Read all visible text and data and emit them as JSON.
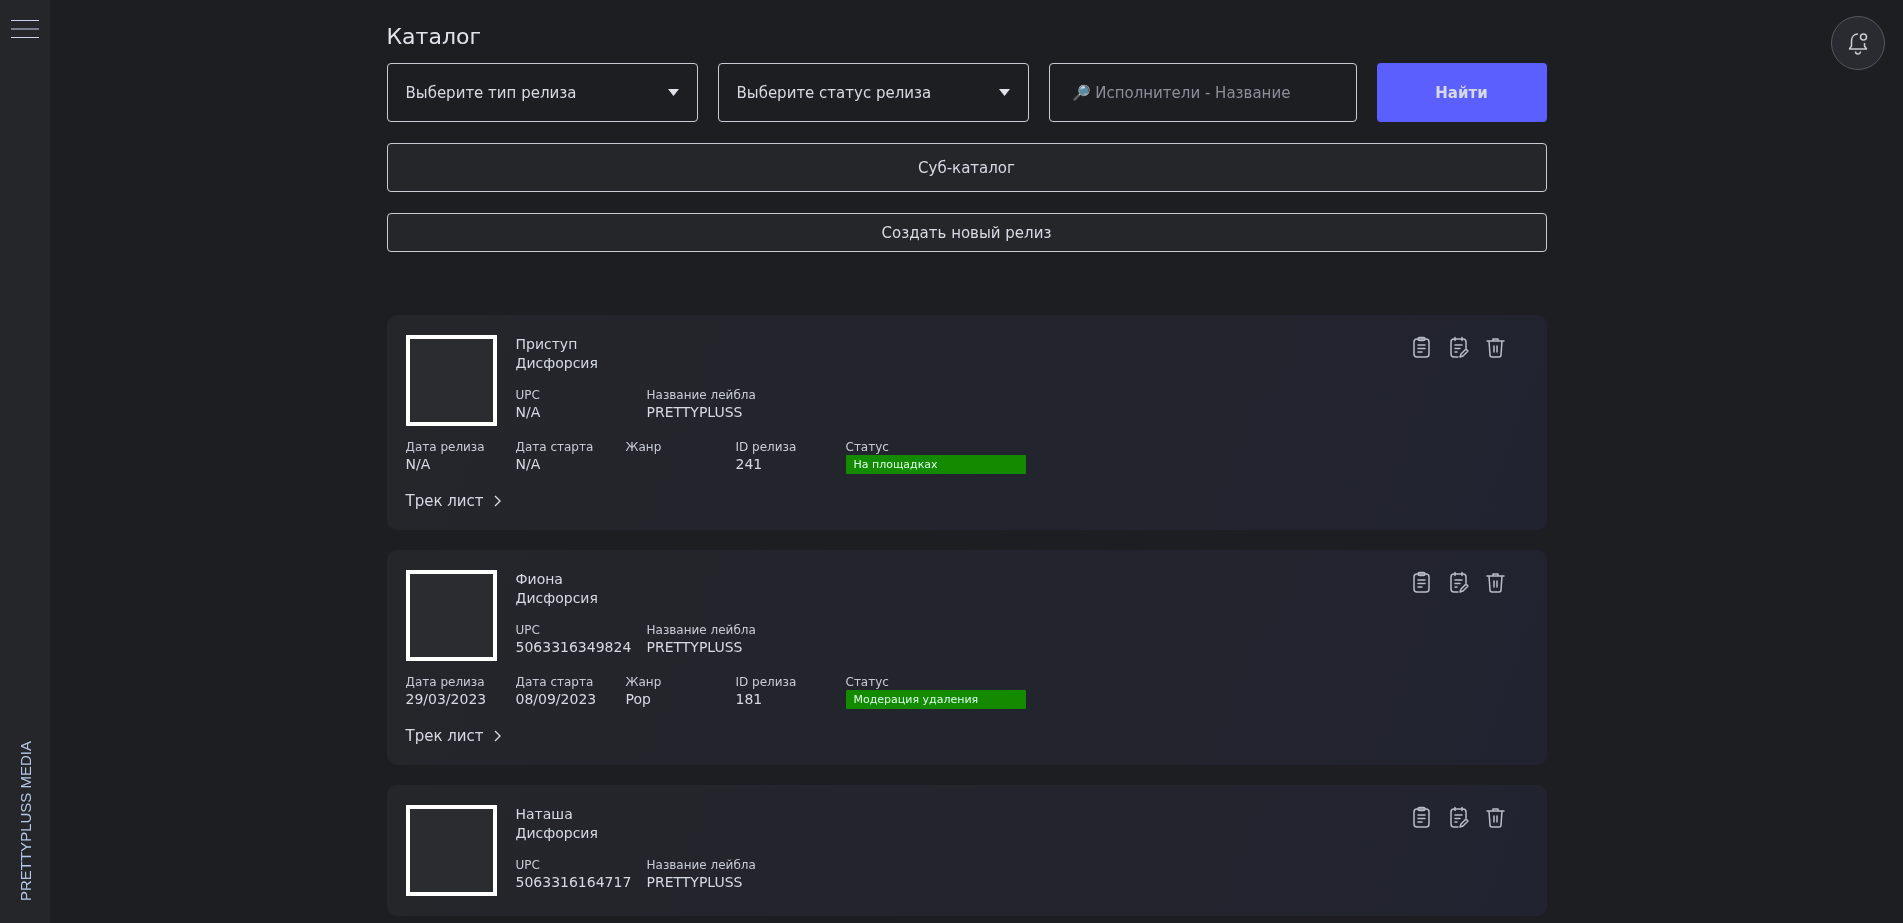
{
  "sidebar": {
    "brand": "PRETTYPLUSS MEDIA"
  },
  "page": {
    "title": "Каталог"
  },
  "filters": {
    "release_type": {
      "placeholder": "Выберите тип релиза"
    },
    "release_status": {
      "placeholder": "Выберите статус релиза"
    },
    "search": {
      "placeholder": "🔎 Исполнители - Название"
    },
    "search_button": "Найти"
  },
  "subcatalog_button": "Суб-каталог",
  "create_button": "Создать новый релиз",
  "releases": [
    {
      "title": "Приступ",
      "artist": "Дисфорсия",
      "upc_label": "UPC",
      "upc": "N/A",
      "label_label": "Название лейбла",
      "label": "PRETTYPLUSS",
      "fields": [
        {
          "label": "Дата релиза",
          "value": "N/A"
        },
        {
          "label": "Дата старта",
          "value": "N/A"
        },
        {
          "label": "Жанр"
        },
        {
          "label": "ID релиза",
          "value": "241"
        }
      ],
      "status_label": "Статус",
      "status": "На площадках",
      "tracklist": "Трек лист"
    },
    {
      "title": "Фиона",
      "artist": "Дисфорсия",
      "upc_label": "UPC",
      "upc": "5063316349824",
      "label_label": "Название лейбла",
      "label": "PRETTYPLUSS",
      "fields": [
        {
          "label": "Дата релиза",
          "value": "29/03/2023"
        },
        {
          "label": "Дата старта",
          "value": "08/09/2023"
        },
        {
          "label": "Жанр",
          "value": "Pop"
        },
        {
          "label": "ID релиза",
          "value": "181"
        }
      ],
      "status_label": "Статус",
      "status": "Модерация удаления",
      "tracklist": "Трек лист"
    },
    {
      "title": "Наташа",
      "artist": "Дисфорсия",
      "upc_label": "UPC",
      "upc": "5063316164717",
      "label_label": "Название лейбла",
      "label": "PRETTYPLUSS"
    }
  ]
}
